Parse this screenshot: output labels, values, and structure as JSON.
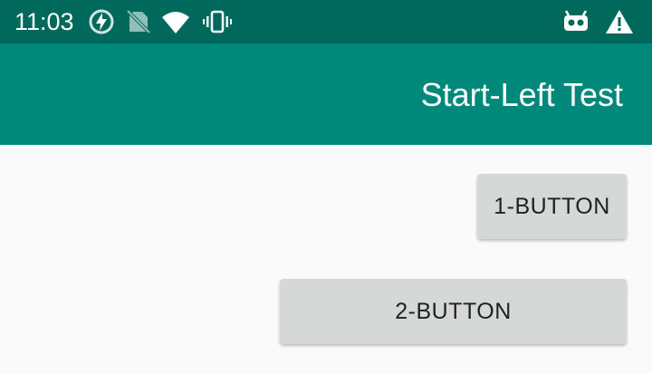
{
  "status_bar": {
    "time": "11:03",
    "icons": [
      "data-saver-icon",
      "no-sim-icon",
      "wifi-icon",
      "vibrate-icon",
      "android-debug-icon",
      "warning-icon"
    ],
    "background": "#00695c"
  },
  "app_bar": {
    "title": "Start-Left Test",
    "background": "#00897b"
  },
  "content": {
    "buttons": [
      {
        "label": "1-BUTTON"
      },
      {
        "label": "2-BUTTON"
      }
    ],
    "button_color": "#d6d7d7",
    "background": "#fafafa"
  }
}
